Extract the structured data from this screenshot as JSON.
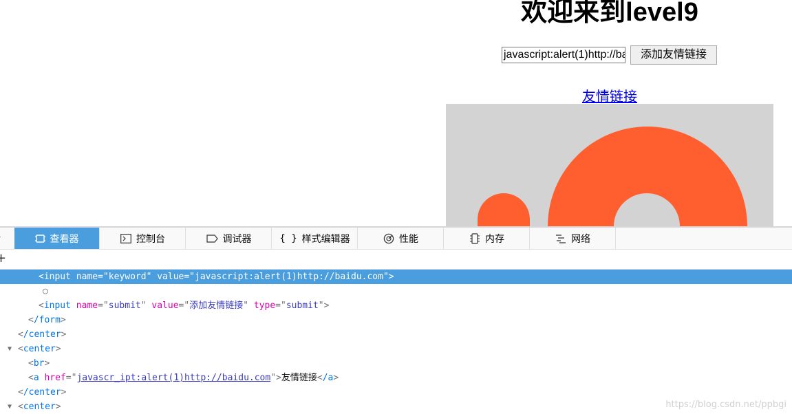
{
  "page": {
    "title": "欢迎来到level9",
    "keyword_input_value": "javascript:alert(1)http://baidu.com",
    "submit_label": "添加友情链接",
    "friend_link_label": "友情链接"
  },
  "devtools": {
    "tabs": [
      {
        "label": "查看器",
        "icon": "inspector-icon",
        "active": true
      },
      {
        "label": "控制台",
        "icon": "console-icon",
        "active": false
      },
      {
        "label": "调试器",
        "icon": "debugger-icon",
        "active": false
      },
      {
        "label": "样式编辑器",
        "icon": "style-editor-icon",
        "active": false
      },
      {
        "label": "性能",
        "icon": "performance-icon",
        "active": false
      },
      {
        "label": "内存",
        "icon": "memory-icon",
        "active": false
      },
      {
        "label": "网络",
        "icon": "network-icon",
        "active": false
      }
    ],
    "markup": {
      "line1": {
        "tag": "input",
        "attr1": "name",
        "val1": "keyword",
        "attr2": "value",
        "val2": "javascript:alert(1)http://baidu.com"
      },
      "line2": {
        "pseudo": "○"
      },
      "line3": {
        "tag": "input",
        "attr1": "name",
        "val1": "submit",
        "attr2": "value",
        "val2": "添加友情链接",
        "attr3": "type",
        "val3": "submit"
      },
      "line4": {
        "tag": "/form"
      },
      "line5": {
        "tag": "/center"
      },
      "line6": {
        "tag": "center"
      },
      "line7": {
        "tag": "br"
      },
      "line8": {
        "tag": "a",
        "attr1": "href",
        "val1": "javascr_ipt:alert(1)http://baidu.com",
        "text": "友情链接",
        "close": "/a"
      },
      "line9": {
        "tag": "/center"
      },
      "line10": {
        "tag": "center"
      }
    }
  },
  "watermark": "https://blog.csdn.net/ppbgi",
  "colors": {
    "active_tab": "#4a9ede",
    "selected_row": "#4a9ede",
    "tag": "#0074e8",
    "attr": "#dd00a9",
    "value": "#3b3bbf",
    "logo_orange": "#ff5f2e",
    "logo_bg": "#d3d3d3"
  }
}
